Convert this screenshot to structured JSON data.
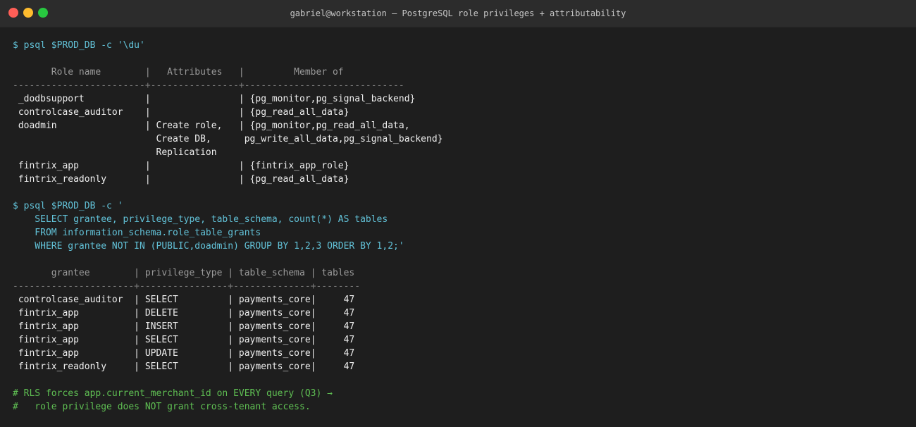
{
  "window": {
    "title": "gabriel@workstation — PostgreSQL role privileges + attributability"
  },
  "terminal": {
    "lines": [
      {
        "kind": "cmd",
        "text": "$ psql $PROD_DB -c '\\du'"
      },
      {
        "kind": "blank",
        "text": ""
      },
      {
        "kind": "hdr",
        "text": "       Role name        |   Attributes   |         Member of"
      },
      {
        "kind": "sep",
        "text": "------------------------+----------------+-----------------------------"
      },
      {
        "kind": "row",
        "text": " _dodbsupport           |                | {pg_monitor,pg_signal_backend}"
      },
      {
        "kind": "row",
        "text": " controlcase_auditor    |                | {pg_read_all_data}"
      },
      {
        "kind": "row",
        "text": " doadmin                | Create role,   | {pg_monitor,pg_read_all_data,"
      },
      {
        "kind": "row",
        "text": "                          Create DB,      pg_write_all_data,pg_signal_backend}"
      },
      {
        "kind": "row",
        "text": "                          Replication"
      },
      {
        "kind": "row",
        "text": " fintrix_app            |                | {fintrix_app_role}"
      },
      {
        "kind": "row",
        "text": " fintrix_readonly       |                | {pg_read_all_data}"
      },
      {
        "kind": "blank",
        "text": ""
      },
      {
        "kind": "cmd",
        "text": "$ psql $PROD_DB -c '"
      },
      {
        "kind": "cmd",
        "text": "    SELECT grantee, privilege_type, table_schema, count(*) AS tables"
      },
      {
        "kind": "cmd",
        "text": "    FROM information_schema.role_table_grants"
      },
      {
        "kind": "cmd",
        "text": "    WHERE grantee NOT IN (PUBLIC,doadmin) GROUP BY 1,2,3 ORDER BY 1,2;'"
      },
      {
        "kind": "blank",
        "text": ""
      },
      {
        "kind": "hdr",
        "text": "       grantee        | privilege_type | table_schema | tables"
      },
      {
        "kind": "sep",
        "text": "----------------------+----------------+--------------+--------"
      },
      {
        "kind": "row",
        "text": " controlcase_auditor  | SELECT         | payments_core|     47"
      },
      {
        "kind": "row",
        "text": " fintrix_app          | DELETE         | payments_core|     47"
      },
      {
        "kind": "row",
        "text": " fintrix_app          | INSERT         | payments_core|     47"
      },
      {
        "kind": "row",
        "text": " fintrix_app          | SELECT         | payments_core|     47"
      },
      {
        "kind": "row",
        "text": " fintrix_app          | UPDATE         | payments_core|     47"
      },
      {
        "kind": "row",
        "text": " fintrix_readonly     | SELECT         | payments_core|     47"
      },
      {
        "kind": "blank",
        "text": ""
      },
      {
        "kind": "cmt",
        "text": "# RLS forces app.current_merchant_id on EVERY query (Q3) →"
      },
      {
        "kind": "cmt",
        "text": "#   role privilege does NOT grant cross-tenant access."
      }
    ]
  }
}
